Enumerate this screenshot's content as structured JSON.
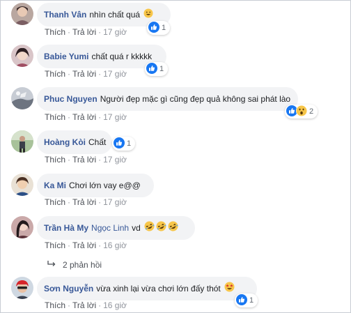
{
  "like_label": "Thích",
  "reply_label": "Trả lời",
  "separator": "·",
  "comments": [
    {
      "author": "Thanh Vân",
      "mention": "",
      "text": "nhìn chất quá",
      "emoji": "smile-emoji",
      "reaction_count": "1",
      "reactions": [
        "like-icon"
      ],
      "time": "17 giờ",
      "avatar": "avatar-thanh-van"
    },
    {
      "author": "Babie Yumi",
      "mention": "",
      "text": "chất quá r kkkkk",
      "emoji": "",
      "reaction_count": "1",
      "reactions": [
        "like-icon"
      ],
      "time": "17 giờ",
      "avatar": "avatar-babie-yumi"
    },
    {
      "author": "Phuc Nguyen",
      "mention": "",
      "text": "Người đẹp mặc gì cũng đẹp quả không sai phát lào",
      "emoji": "",
      "reaction_count": "2",
      "reactions": [
        "like-icon",
        "wow-icon"
      ],
      "time": "17 giờ",
      "avatar": "avatar-phuc-nguyen"
    },
    {
      "author": "Hoàng Kòi",
      "mention": "",
      "text": "Chất",
      "emoji": "",
      "reaction_count": "1",
      "reactions": [
        "like-icon"
      ],
      "time": "17 giờ",
      "avatar": "avatar-hoang-koi"
    },
    {
      "author": "Ka Mi",
      "mention": "",
      "text": "Chơi lớn vay e@@",
      "emoji": "",
      "reaction_count": "",
      "reactions": [],
      "time": "17 giờ",
      "avatar": "avatar-ka-mi"
    },
    {
      "author": "Trần Hà My",
      "mention": "Ngọc Linh",
      "text": "vd",
      "emoji": "rofl-emoji",
      "reaction_count": "",
      "reactions": [],
      "time": "16 giờ",
      "avatar": "avatar-tran-ha-my"
    },
    {
      "author": "Sơn Nguyễn",
      "mention": "",
      "text": "vừa xinh lại vừa chơi lớn đấy thót",
      "emoji": "star-struck-emoji",
      "reaction_count": "1",
      "reactions": [
        "like-icon"
      ],
      "time": "16 giờ",
      "avatar": "avatar-son-nguyen"
    }
  ],
  "replies_link": "2 phản hồi",
  "colors": {
    "author": "#385898",
    "bubble": "#f2f3f5",
    "meta": "#90949c",
    "like_blue": "#1877f2",
    "wow_yellow": "#f7c64a"
  }
}
